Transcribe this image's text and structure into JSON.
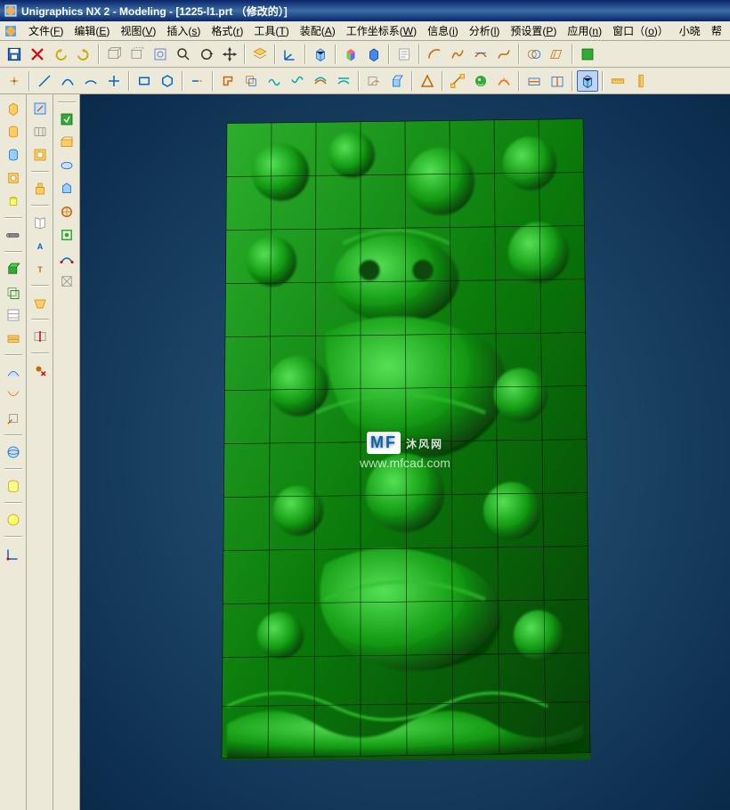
{
  "window": {
    "title": "Unigraphics NX 2 - Modeling - [1225-l1.prt （修改的）]"
  },
  "menu": {
    "items": [
      {
        "label": "文件",
        "accel": "F"
      },
      {
        "label": "编辑",
        "accel": "E"
      },
      {
        "label": "视图",
        "accel": "V"
      },
      {
        "label": "插入",
        "accel": "s"
      },
      {
        "label": "格式",
        "accel": "r"
      },
      {
        "label": "工具",
        "accel": "T"
      },
      {
        "label": "装配",
        "accel": "A"
      },
      {
        "label": "工作坐标系",
        "accel": "W"
      },
      {
        "label": "信息",
        "accel": "i"
      },
      {
        "label": "分析",
        "accel": "l"
      },
      {
        "label": "预设置",
        "accel": "P"
      },
      {
        "label": "应用",
        "accel": "n"
      },
      {
        "label": "窗口（",
        "accel": "o",
        "suffix": "）"
      },
      {
        "label": "小晓",
        "accel": ""
      },
      {
        "label": "帮",
        "accel": ""
      }
    ]
  },
  "toolbar_row1": {
    "items": [
      {
        "name": "save-icon",
        "glyph": "save"
      },
      {
        "name": "delete-x-icon",
        "glyph": "red-x"
      },
      {
        "name": "undo-icon",
        "glyph": "undo"
      },
      {
        "name": "redo-icon",
        "glyph": "redo"
      },
      {
        "name": "sep"
      },
      {
        "name": "wireframe-icon",
        "glyph": "wire"
      },
      {
        "name": "hidden-view-icon",
        "glyph": "hidden"
      },
      {
        "name": "fit-icon",
        "glyph": "fit"
      },
      {
        "name": "zoom-icon",
        "glyph": "zoom"
      },
      {
        "name": "rotate-icon",
        "glyph": "rotate"
      },
      {
        "name": "pan-icon",
        "glyph": "pan"
      },
      {
        "name": "sep"
      },
      {
        "name": "layer-icon",
        "glyph": "layer"
      },
      {
        "name": "sep"
      },
      {
        "name": "wcs-icon",
        "glyph": "wcs"
      },
      {
        "name": "sep"
      },
      {
        "name": "cube-icon",
        "glyph": "cube"
      },
      {
        "name": "sep"
      },
      {
        "name": "color-cube-icon",
        "glyph": "colorcube"
      },
      {
        "name": "blue-cube-icon",
        "glyph": "bluecube"
      },
      {
        "name": "sep"
      },
      {
        "name": "sheet-icon",
        "glyph": "sheet"
      },
      {
        "name": "sep"
      },
      {
        "name": "arc-icon",
        "glyph": "arc"
      },
      {
        "name": "curve-s-icon",
        "glyph": "scurve"
      },
      {
        "name": "tangent-icon",
        "glyph": "tang"
      },
      {
        "name": "spline-icon",
        "glyph": "spl"
      },
      {
        "name": "sep"
      },
      {
        "name": "intersect-icon",
        "glyph": "isect"
      },
      {
        "name": "project-icon",
        "glyph": "proj"
      },
      {
        "name": "sep"
      },
      {
        "name": "analyze-green-icon",
        "glyph": "analyze"
      }
    ]
  },
  "toolbar_row2": {
    "items": [
      {
        "name": "point-icon",
        "glyph": "point"
      },
      {
        "name": "sep"
      },
      {
        "name": "line-icon",
        "glyph": "line"
      },
      {
        "name": "sketch-curve-icon",
        "glyph": "sk"
      },
      {
        "name": "arc2-icon",
        "glyph": "arc2"
      },
      {
        "name": "cross-icon",
        "glyph": "cross"
      },
      {
        "name": "sep"
      },
      {
        "name": "rect-icon",
        "glyph": "rect"
      },
      {
        "name": "hex-icon",
        "glyph": "hex"
      },
      {
        "name": "sep"
      },
      {
        "name": "trim-icon",
        "glyph": "trim"
      },
      {
        "name": "sep"
      },
      {
        "name": "contour-icon",
        "glyph": "contour"
      },
      {
        "name": "offset-curve-icon",
        "glyph": "offset"
      },
      {
        "name": "wave-icon",
        "glyph": "wave"
      },
      {
        "name": "wave2-icon",
        "glyph": "wave2"
      },
      {
        "name": "wave3-icon",
        "glyph": "wave3"
      },
      {
        "name": "wave4-icon",
        "glyph": "wave4"
      },
      {
        "name": "sep"
      },
      {
        "name": "box-curve-icon",
        "glyph": "boxcurve"
      },
      {
        "name": "extrude-icon",
        "glyph": "extrude2"
      },
      {
        "name": "sep"
      },
      {
        "name": "tri-icon",
        "glyph": "tri"
      },
      {
        "name": "sep"
      },
      {
        "name": "measure-dist-icon",
        "glyph": "measure"
      },
      {
        "name": "dragon-icon",
        "glyph": "dragon"
      },
      {
        "name": "deviation-icon",
        "glyph": "dev"
      },
      {
        "name": "sep"
      },
      {
        "name": "section-icon",
        "glyph": "section"
      },
      {
        "name": "section2-icon",
        "glyph": "section2"
      },
      {
        "name": "sep"
      },
      {
        "name": "shade-box-icon",
        "glyph": "shadebox",
        "active": true
      },
      {
        "name": "sep"
      },
      {
        "name": "ruler-h-icon",
        "glyph": "ruler"
      },
      {
        "name": "ruler-v-icon",
        "glyph": "ruler2"
      }
    ]
  },
  "sidebars": {
    "col1": [
      {
        "name": "block-icon"
      },
      {
        "name": "cylinder-icon"
      },
      {
        "name": "cylinder2-icon"
      },
      {
        "name": "hole-icon"
      },
      {
        "name": "cylinder-yel-icon"
      },
      {
        "name": "sep"
      },
      {
        "name": "rod-icon"
      },
      {
        "name": "sep"
      },
      {
        "name": "extrude-box-icon"
      },
      {
        "name": "offset-face-icon"
      },
      {
        "name": "sheet-body-icon"
      },
      {
        "name": "thicken-icon"
      },
      {
        "name": "sep"
      },
      {
        "name": "sweep-icon"
      },
      {
        "name": "sweep2-icon"
      },
      {
        "name": "scale-icon"
      },
      {
        "name": "sep"
      },
      {
        "name": "sphere-icon"
      },
      {
        "name": "sep"
      },
      {
        "name": "cylinder-prim-icon"
      },
      {
        "name": "sep"
      },
      {
        "name": "sphere-prim-icon"
      },
      {
        "name": "sep"
      },
      {
        "name": "datum-icon"
      }
    ],
    "col2": [
      {
        "name": "face-edit-icon"
      },
      {
        "name": "ruled-icon"
      },
      {
        "name": "pocket-icon"
      },
      {
        "name": "sep"
      },
      {
        "name": "boss-small-icon"
      },
      {
        "name": "sep"
      },
      {
        "name": "book-icon"
      },
      {
        "name": "text-icon"
      },
      {
        "name": "text2-icon"
      },
      {
        "name": "sep"
      },
      {
        "name": "pocket2-icon"
      },
      {
        "name": "sep"
      },
      {
        "name": "split-icon"
      },
      {
        "name": "sep"
      },
      {
        "name": "delete-point-icon"
      }
    ],
    "col3": [
      {
        "name": "sep"
      },
      {
        "name": "grn1-icon"
      },
      {
        "name": "grn2-icon"
      },
      {
        "name": "grn3-icon"
      },
      {
        "name": "grn4-icon"
      },
      {
        "name": "grn5-icon"
      },
      {
        "name": "grn6-icon"
      },
      {
        "name": "grn7-icon"
      },
      {
        "name": "grn8-icon"
      }
    ]
  },
  "watermark": {
    "brand": "MF",
    "text": "沐风网",
    "url": "www.mfcad.com"
  }
}
